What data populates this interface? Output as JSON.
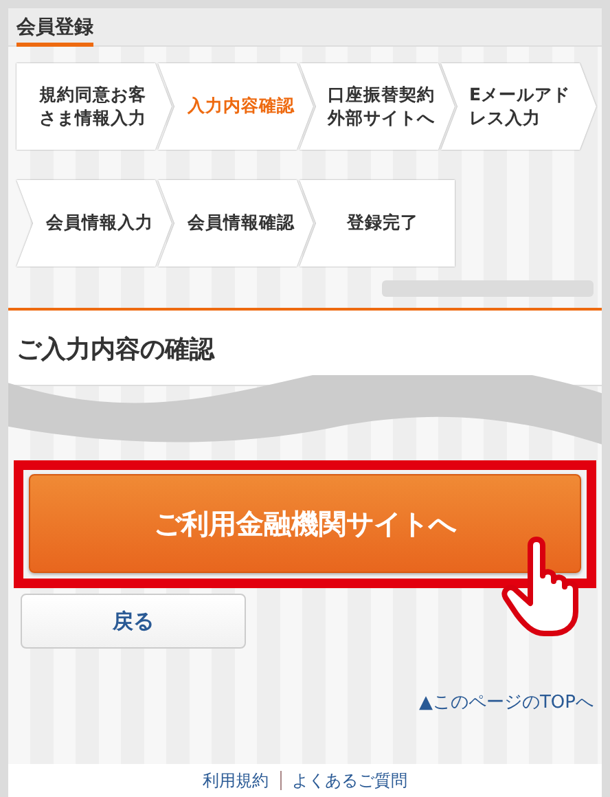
{
  "header": {
    "title": "会員登録"
  },
  "steps": [
    {
      "label": "規約同意お客さま情報入力",
      "selected": false
    },
    {
      "label": "入力内容確認",
      "selected": true
    },
    {
      "label": "口座振替契約外部サイトへ",
      "selected": false
    },
    {
      "label": "Eメールアドレス入力",
      "selected": false
    },
    {
      "label": "会員情報入力",
      "selected": false
    },
    {
      "label": "会員情報確認",
      "selected": false
    },
    {
      "label": "登録完了",
      "selected": false
    }
  ],
  "section": {
    "title": "ご入力内容の確認"
  },
  "primary_button": "ご利用金融機関サイトへ",
  "back_button": "戻る",
  "top_link": "▲このページのTOPへ",
  "footer_links": [
    "利用規約",
    "よくあるご質問"
  ]
}
